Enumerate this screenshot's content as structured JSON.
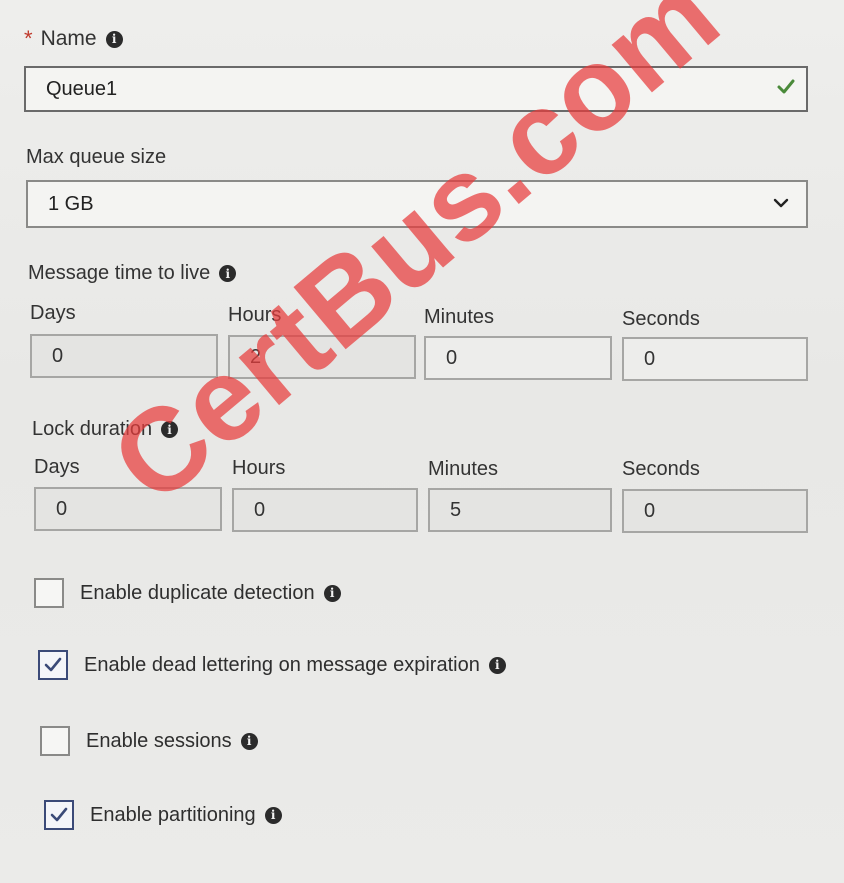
{
  "name": {
    "required_mark": "*",
    "label": "Name",
    "info_icon": "info-icon",
    "value": "Queue1",
    "valid_icon": "checkmark-icon"
  },
  "max_queue_size": {
    "label": "Max queue size",
    "selected": "1 GB",
    "dropdown_icon": "chevron-down-icon"
  },
  "message_ttl": {
    "label": "Message time to live",
    "info_icon": "info-icon",
    "fields": [
      {
        "label": "Days",
        "value": "0"
      },
      {
        "label": "Hours",
        "value": "2"
      },
      {
        "label": "Minutes",
        "value": "0"
      },
      {
        "label": "Seconds",
        "value": "0"
      }
    ]
  },
  "lock_duration": {
    "label": "Lock duration",
    "info_icon": "info-icon",
    "fields": [
      {
        "label": "Days",
        "value": "0"
      },
      {
        "label": "Hours",
        "value": "0"
      },
      {
        "label": "Minutes",
        "value": "5"
      },
      {
        "label": "Seconds",
        "value": "0"
      }
    ]
  },
  "options": [
    {
      "label": "Enable duplicate detection",
      "checked": false
    },
    {
      "label": "Enable dead lettering on message expiration",
      "checked": true
    },
    {
      "label": "Enable sessions",
      "checked": false
    },
    {
      "label": "Enable partitioning",
      "checked": true
    }
  ],
  "watermark": "CertBus.com",
  "colors": {
    "valid_check": "#4a8a3a",
    "checkbox_check": "#3b4a78",
    "watermark": "#e83c3c"
  }
}
